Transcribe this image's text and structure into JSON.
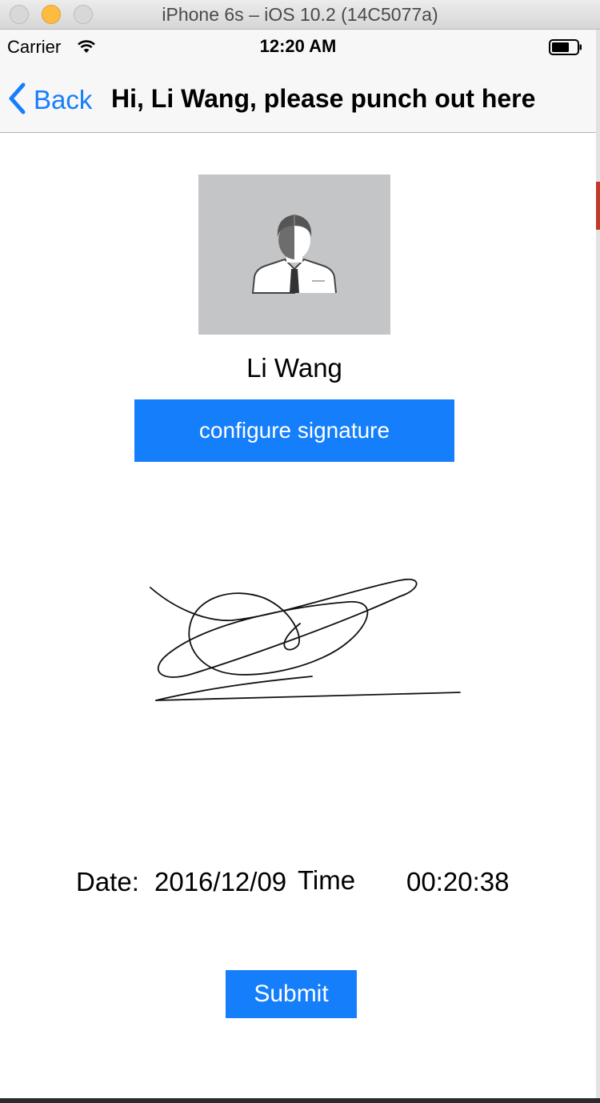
{
  "window": {
    "title": "iPhone 6s – iOS 10.2 (14C5077a)"
  },
  "status_bar": {
    "carrier": "Carrier",
    "time": "12:20 AM",
    "icons": [
      "wifi-icon",
      "battery-icon"
    ]
  },
  "nav": {
    "back_label": "Back",
    "title": "Hi, Li Wang, please punch out here",
    "accent_color": "#157efb"
  },
  "profile": {
    "name": "Li Wang",
    "avatar_icon": "person-avatar-icon"
  },
  "actions": {
    "configure_label": "configure signature",
    "submit_label": "Submit",
    "button_color": "#157efb"
  },
  "punch": {
    "date_label": "Date:",
    "date_value": "2016/12/09",
    "time_label": "Time",
    "time_value": "00:20:38"
  }
}
